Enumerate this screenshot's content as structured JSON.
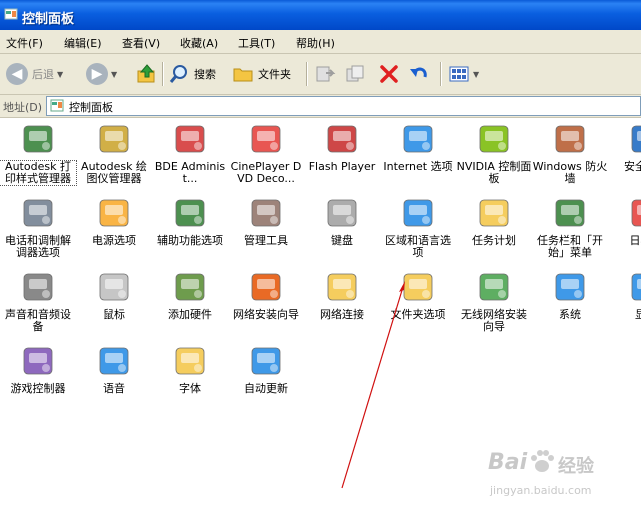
{
  "window": {
    "title": "控制面板"
  },
  "menu": [
    {
      "label": "文件(F)",
      "name": "menu-file"
    },
    {
      "label": "编辑(E)",
      "name": "menu-edit"
    },
    {
      "label": "查看(V)",
      "name": "menu-view"
    },
    {
      "label": "收藏(A)",
      "name": "menu-favorites"
    },
    {
      "label": "工具(T)",
      "name": "menu-tools"
    },
    {
      "label": "帮助(H)",
      "name": "menu-help"
    }
  ],
  "toolbar": {
    "back_label": "后退",
    "search_label": "搜索",
    "folders_label": "文件夹"
  },
  "address": {
    "label": "地址(D)",
    "value": "控制面板"
  },
  "items": [
    {
      "label": "Autodesk 打印样式管理器",
      "icon": "printer-styles-icon",
      "color": "#2e7d32"
    },
    {
      "label": "Autodesk 绘图仪管理器",
      "icon": "plotter-manager-icon",
      "color": "#c9a227"
    },
    {
      "label": "BDE Administ...",
      "icon": "bde-admin-icon",
      "color": "#d32f2f"
    },
    {
      "label": "CinePlayer DVD Deco...",
      "icon": "cineplayer-icon",
      "color": "#e53935"
    },
    {
      "label": "Flash Player",
      "icon": "flash-player-icon",
      "color": "#c62828"
    },
    {
      "label": "Internet 选项",
      "icon": "internet-options-icon",
      "color": "#1e88e5"
    },
    {
      "label": "NVIDIA 控制面板",
      "icon": "nvidia-icon",
      "color": "#76b900"
    },
    {
      "label": "Windows 防火墙",
      "icon": "firewall-icon",
      "color": "#b5562a"
    },
    {
      "label": "安全中心",
      "icon": "security-center-icon",
      "color": "#1565c0"
    },
    {
      "label": "电话和调制解调器选项",
      "icon": "phone-modem-icon",
      "color": "#6d7b8c"
    },
    {
      "label": "电源选项",
      "icon": "power-options-icon",
      "color": "#f9a825"
    },
    {
      "label": "辅助功能选项",
      "icon": "accessibility-icon",
      "color": "#2e7d32"
    },
    {
      "label": "管理工具",
      "icon": "admin-tools-icon",
      "color": "#8d6e63"
    },
    {
      "label": "键盘",
      "icon": "keyboard-icon",
      "color": "#9e9e9e"
    },
    {
      "label": "区域和语言选项",
      "icon": "regional-language-icon",
      "color": "#1e88e5"
    },
    {
      "label": "任务计划",
      "icon": "scheduled-tasks-icon",
      "color": "#f4c542"
    },
    {
      "label": "任务栏和「开始」菜单",
      "icon": "taskbar-start-icon",
      "color": "#2e7d32"
    },
    {
      "label": "日期和",
      "icon": "date-time-icon",
      "color": "#e53935"
    },
    {
      "label": "声音和音频设备",
      "icon": "sound-audio-icon",
      "color": "#757575"
    },
    {
      "label": "鼠标",
      "icon": "mouse-icon",
      "color": "#bdbdbd"
    },
    {
      "label": "添加硬件",
      "icon": "add-hardware-icon",
      "color": "#558b2f"
    },
    {
      "label": "网络安装向导",
      "icon": "network-setup-icon",
      "color": "#e65100"
    },
    {
      "label": "网络连接",
      "icon": "network-connections-icon",
      "color": "#f4c542"
    },
    {
      "label": "文件夹选项",
      "icon": "folder-options-icon",
      "color": "#f4c542"
    },
    {
      "label": "无线网络安装向导",
      "icon": "wireless-network-icon",
      "color": "#43a047"
    },
    {
      "label": "系统",
      "icon": "system-icon",
      "color": "#1e88e5"
    },
    {
      "label": "显示",
      "icon": "display-icon",
      "color": "#1e88e5"
    },
    {
      "label": "游戏控制器",
      "icon": "game-controller-icon",
      "color": "#7b4fb3"
    },
    {
      "label": "语音",
      "icon": "speech-icon",
      "color": "#1e88e5"
    },
    {
      "label": "字体",
      "icon": "fonts-icon",
      "color": "#f4c542"
    },
    {
      "label": "自动更新",
      "icon": "automatic-updates-icon",
      "color": "#1e88e5"
    }
  ],
  "watermark": {
    "brand": "Bai",
    "brand2": "经验",
    "url": "jingyan.baidu.com"
  }
}
